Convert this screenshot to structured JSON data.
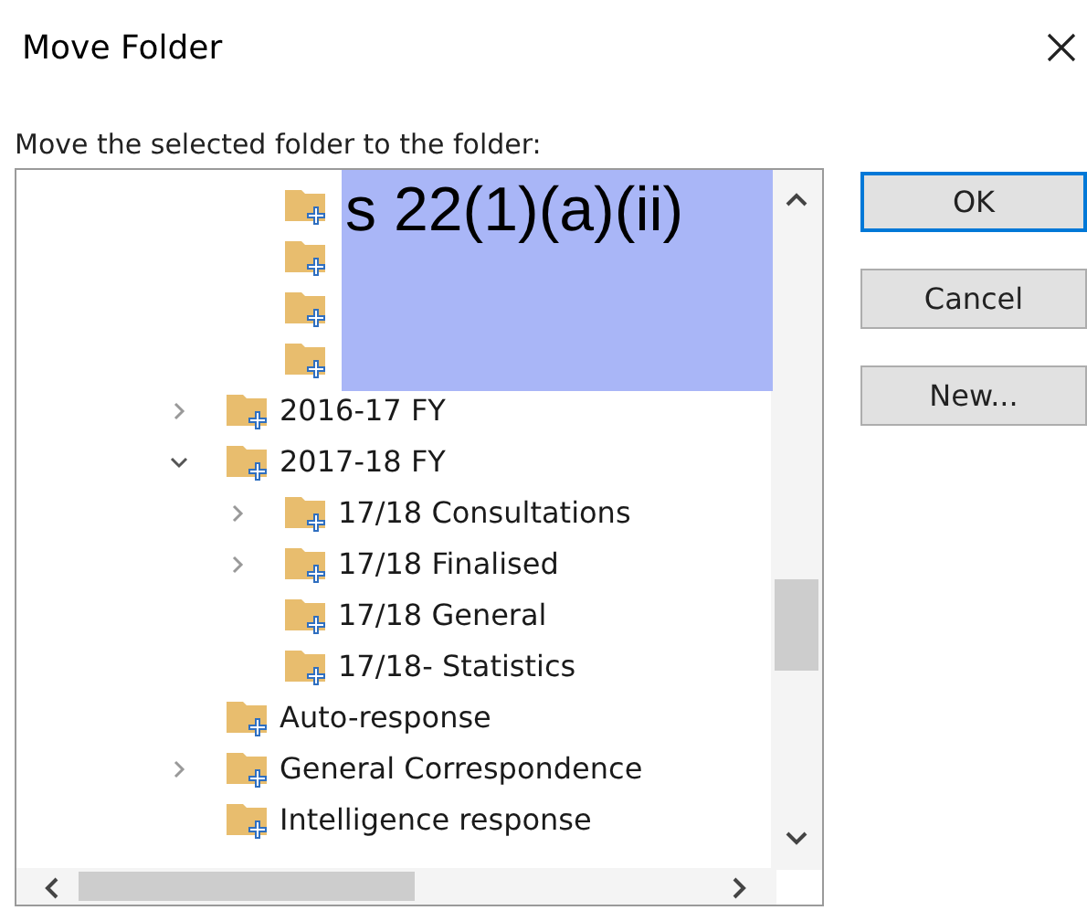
{
  "window": {
    "title": "Move Folder"
  },
  "prompt": "Move the selected folder to the folder:",
  "tree": {
    "items": [
      {
        "kind": "scrolled_parent",
        "children": [
          {
            "kind": "redacted"
          },
          {
            "kind": "redacted"
          },
          {
            "kind": "redacted"
          },
          {
            "kind": "redacted"
          }
        ]
      },
      {
        "kind": "folder",
        "label": "2016-17 FY",
        "expanded": false
      },
      {
        "kind": "folder",
        "label": "2017-18 FY",
        "expanded": true,
        "children": [
          {
            "kind": "folder",
            "label": "17/18 Consultations",
            "expanded": false
          },
          {
            "kind": "folder",
            "label": "17/18 Finalised",
            "expanded": false
          },
          {
            "kind": "folder",
            "label": "17/18 General"
          },
          {
            "kind": "folder",
            "label": "17/18- Statistics"
          }
        ]
      },
      {
        "kind": "folder",
        "label": "Auto-response"
      },
      {
        "kind": "folder",
        "label": "General Correspondence",
        "expanded": false
      },
      {
        "kind": "folder",
        "label": "Intelligence response"
      }
    ]
  },
  "redaction": {
    "label": "s 22(1)(a)(ii)"
  },
  "buttons": [
    {
      "label": "OK",
      "default": true
    },
    {
      "label": "Cancel",
      "default": false
    },
    {
      "label": "New...",
      "default": false
    }
  ]
}
